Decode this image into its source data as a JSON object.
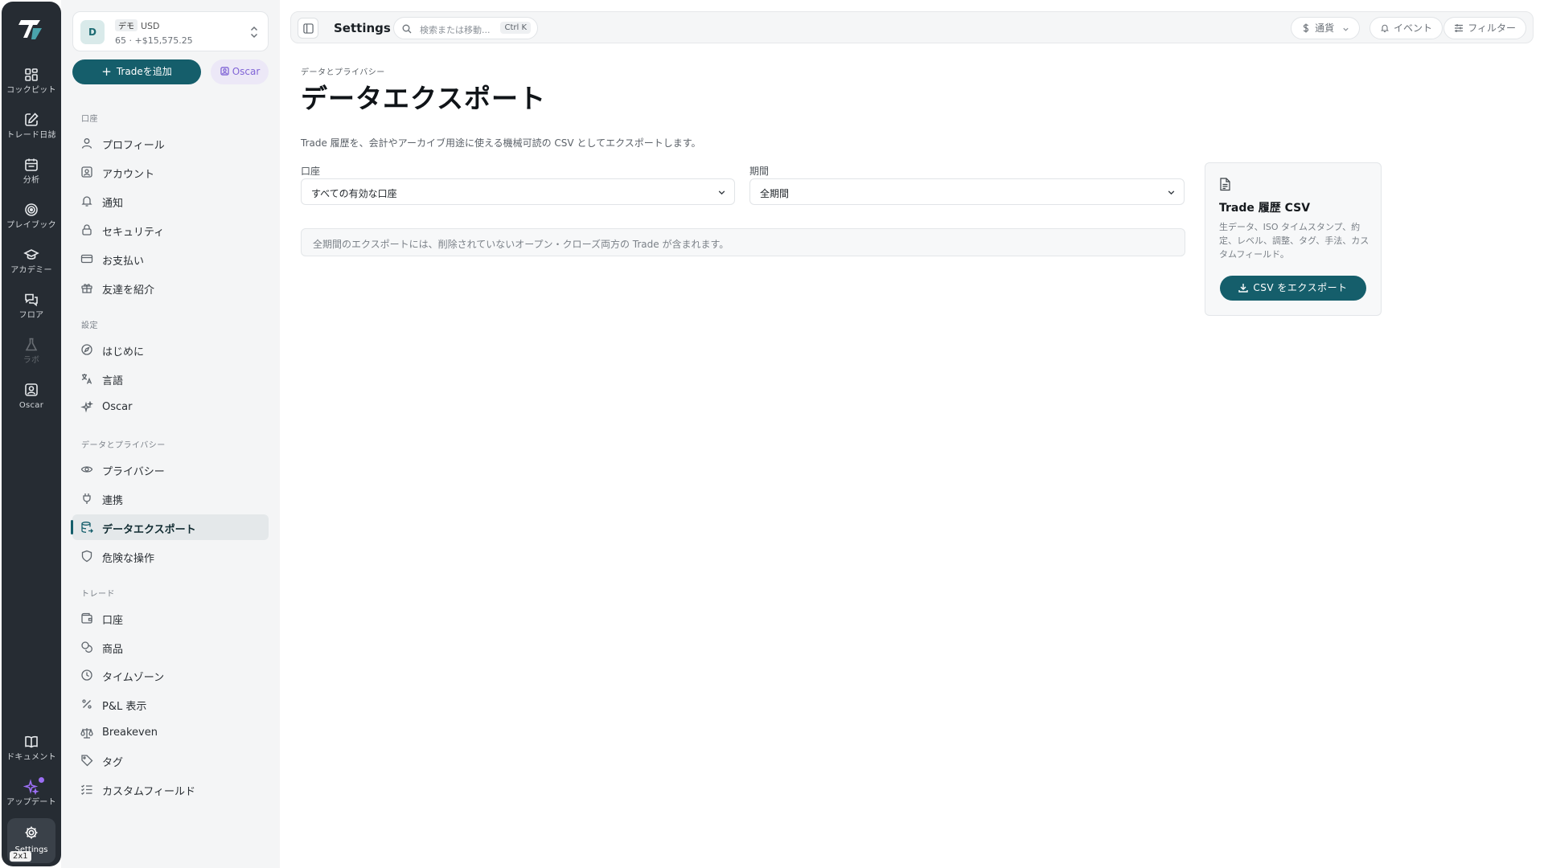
{
  "rail": {
    "items": [
      {
        "label": "コックピット",
        "icon": "dashboard-grid-icon"
      },
      {
        "label": "トレード日誌",
        "icon": "journal-edit-icon"
      },
      {
        "label": "分析",
        "icon": "calendar-icon"
      },
      {
        "label": "プレイブック",
        "icon": "target-icon"
      },
      {
        "label": "アカデミー",
        "icon": "graduation-cap-icon"
      },
      {
        "label": "フロア",
        "icon": "chat-bubbles-icon"
      },
      {
        "label": "ラボ",
        "icon": "flask-icon"
      },
      {
        "label": "Oscar",
        "icon": "oscar-portrait-icon"
      }
    ],
    "bottom": [
      {
        "label": "ドキュメント",
        "icon": "book-icon"
      },
      {
        "label": "アップデート",
        "icon": "sparkle-icon"
      }
    ],
    "settings_label": "Settings",
    "badge": "2x1"
  },
  "account": {
    "avatar": "D",
    "mode": "デモ",
    "currency": "USD",
    "summary": "65 · +$15,575.25"
  },
  "sidebar": {
    "add_trade": "Tradeを追加",
    "oscar_button": "Oscar",
    "sections": [
      {
        "title": "口座",
        "items": [
          "プロフィール",
          "アカウント",
          "通知",
          "セキュリティ",
          "お支払い",
          "友達を紹介"
        ]
      },
      {
        "title": "設定",
        "items": [
          "はじめに",
          "言語",
          "Oscar"
        ]
      },
      {
        "title": "データとプライバシー",
        "items": [
          "プライバシー",
          "連携",
          "データエクスポート",
          "危険な操作"
        ]
      },
      {
        "title": "トレード",
        "items": [
          "口座",
          "商品",
          "タイムゾーン",
          "P&L 表示",
          "Breakeven",
          "タグ",
          "カスタムフィールド"
        ]
      }
    ]
  },
  "topbar": {
    "title": "Settings",
    "search_placeholder": "検索または移動...",
    "shortcut": "Ctrl K",
    "currency": "通貨",
    "events": "イベント",
    "filters": "フィルター"
  },
  "page": {
    "breadcrumb": "データとプライバシー",
    "title": "データエクスポート",
    "description": "Trade 履歴を、会計やアーカイブ用途に使える機械可読の CSV としてエクスポートします。",
    "account_label": "口座",
    "account_value": "すべての有効な口座",
    "period_label": "期間",
    "period_value": "全期間",
    "note": "全期間のエクスポートには、削除されていないオープン・クローズ両方の Trade が含まれます。"
  },
  "card": {
    "title": "Trade 履歴 CSV",
    "description": "生データ、ISO タイムスタンプ、約定、レベル、調整、タグ、手法、カスタムフィールド。",
    "button": "CSV をエクスポート"
  },
  "colors": {
    "accent": "#155e6b",
    "rail_bg": "#262c33",
    "sidebar_bg": "#f4f5f6",
    "oscar_purple": "#8064d6"
  }
}
